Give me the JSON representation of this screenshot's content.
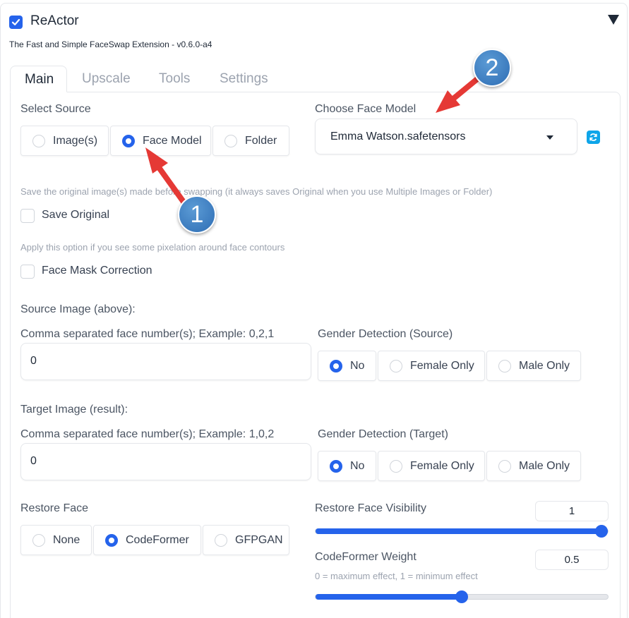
{
  "header": {
    "title": "ReActor",
    "subtitle": "The Fast and Simple FaceSwap Extension - v0.6.0-a4",
    "checked": true
  },
  "tabs": [
    {
      "label": "Main",
      "active": true
    },
    {
      "label": "Upscale",
      "active": false
    },
    {
      "label": "Tools",
      "active": false
    },
    {
      "label": "Settings",
      "active": false
    }
  ],
  "select_source": {
    "label": "Select Source",
    "options": [
      "Image(s)",
      "Face Model",
      "Folder"
    ],
    "selected": "Face Model"
  },
  "face_model": {
    "label": "Choose Face Model",
    "value": "Emma Watson.safetensors",
    "refresh_icon": "refresh-icon"
  },
  "save_original": {
    "info": "Save the original image(s) made before swapping (it always saves Original when you use Multiple Images or Folder)",
    "label": "Save Original",
    "checked": false
  },
  "face_mask": {
    "info": "Apply this option if you see some pixelation around face contours",
    "label": "Face Mask Correction",
    "checked": false
  },
  "source_image": {
    "heading": "Source Image (above):",
    "faces_label": "Comma separated face number(s); Example: 0,2,1",
    "faces_value": "0",
    "gender_label": "Gender Detection (Source)",
    "gender_options": [
      "No",
      "Female Only",
      "Male Only"
    ],
    "gender_selected": "No"
  },
  "target_image": {
    "heading": "Target Image (result):",
    "faces_label": "Comma separated face number(s); Example: 1,0,2",
    "faces_value": "0",
    "gender_label": "Gender Detection (Target)",
    "gender_options": [
      "No",
      "Female Only",
      "Male Only"
    ],
    "gender_selected": "No"
  },
  "restore_face": {
    "label": "Restore Face",
    "options": [
      "None",
      "CodeFormer",
      "GFPGAN"
    ],
    "selected": "CodeFormer"
  },
  "restore_visibility": {
    "label": "Restore Face Visibility",
    "value": "1",
    "fraction": 1.0
  },
  "codeformer_weight": {
    "label": "CodeFormer Weight",
    "value": "0.5",
    "info": "0 = maximum effect, 1 = minimum effect",
    "fraction": 0.5
  },
  "annotations": {
    "badge_1": "1",
    "badge_2": "2",
    "arrow_color": "#e53935"
  },
  "colors": {
    "accent": "#2563eb",
    "refresh": "#0ea5e9",
    "badge": "#3a7bc8"
  }
}
